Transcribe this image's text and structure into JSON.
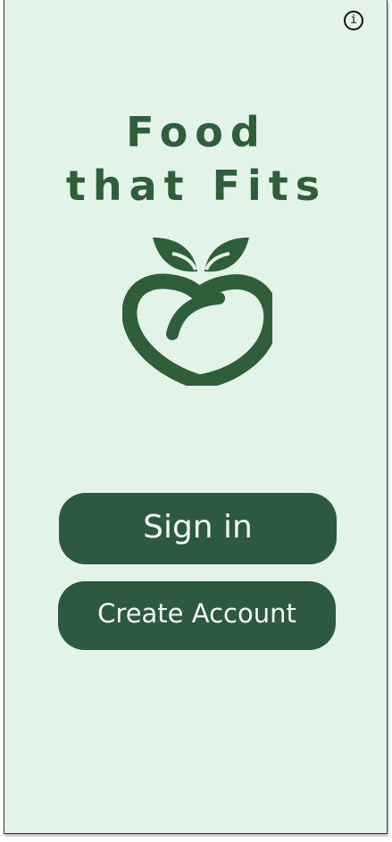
{
  "app": {
    "title_line1": "Food",
    "title_line2": "that Fits",
    "logo_icon": "apple-heart-icon",
    "info_label": "i"
  },
  "actions": {
    "sign_in_label": "Sign in",
    "create_account_label": "Create Account"
  },
  "colors": {
    "background": "#e4f3e8",
    "brand_green": "#2f5f3a",
    "button_green": "#2d5a3e",
    "button_text": "#f3f7f3"
  }
}
